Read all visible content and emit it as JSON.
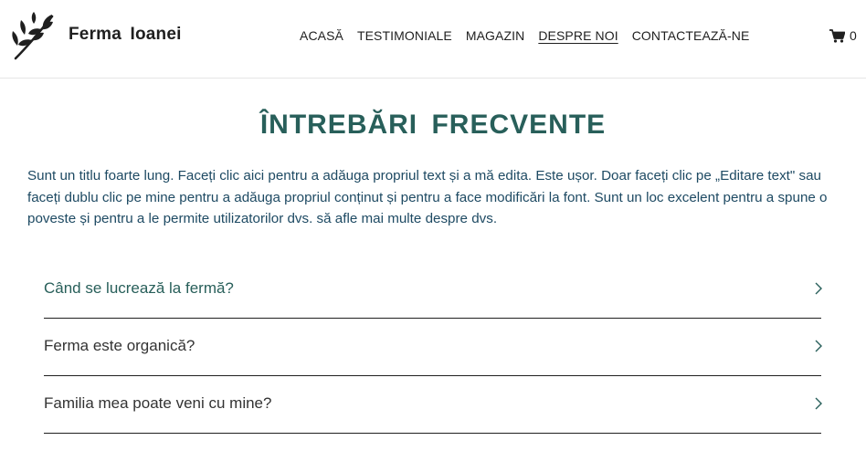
{
  "header": {
    "brand": "Ferma Ioanei",
    "nav": [
      "ACASĂ",
      "TESTIMONIALE",
      "MAGAZIN",
      "DESPRE NOI",
      "CONTACTEAZĂ-NE"
    ],
    "active_nav": "DESPRE NOI",
    "cart_count": "0"
  },
  "main": {
    "title": "ÎNTREBĂRI FRECVENTE",
    "intro": "Sunt un titlu foarte lung. Faceți clic aici pentru a adăuga propriul text și a mă edita. Este ușor. Doar faceți clic pe „Editare text\" sau faceți dublu clic pe mine pentru a adăuga propriul conținut și pentru a face modificări la font. Sunt un loc excelent pentru a spune o poveste și pentru a le permite utilizatorilor dvs. să afle mai multe despre dvs.",
    "faq": [
      "Când se lucrează la fermă?",
      "Ferma este organică?",
      "Familia mea poate veni cu mine?"
    ]
  },
  "colors": {
    "accent": "#285f5a",
    "intro_text": "#1e4a63"
  },
  "icons": {
    "logo": "leaf-branch-icon",
    "cart": "shopping-cart-icon",
    "faq_toggle": "chevron-right-icon"
  }
}
